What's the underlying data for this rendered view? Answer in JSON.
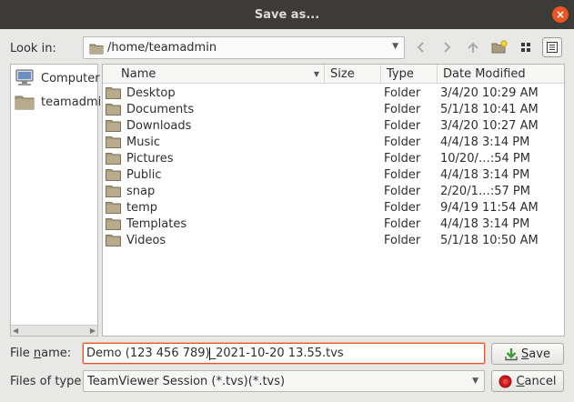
{
  "window": {
    "title": "Save as...",
    "close_glyph": "×"
  },
  "lookin": {
    "label": "Look in:",
    "path": "/home/teamadmin"
  },
  "toolbar_icons": [
    "back-icon",
    "forward-icon",
    "up-directory-icon",
    "new-folder-icon",
    "icon-view-icon",
    "detail-view-icon"
  ],
  "places": [
    {
      "label": "Computer",
      "icon": "computer-icon"
    },
    {
      "label": "teamadmin",
      "icon": "folder-icon"
    }
  ],
  "columns": {
    "name": "Name",
    "size": "Size",
    "type": "Type",
    "date": "Date Modified"
  },
  "files": [
    {
      "name": "Desktop",
      "type": "Folder",
      "date": "3/4/20 10:29 AM"
    },
    {
      "name": "Documents",
      "type": "Folder",
      "date": "5/1/18 10:41 AM"
    },
    {
      "name": "Downloads",
      "type": "Folder",
      "date": "3/4/20 10:27 AM"
    },
    {
      "name": "Music",
      "type": "Folder",
      "date": "4/4/18 3:14 PM"
    },
    {
      "name": "Pictures",
      "type": "Folder",
      "date": "10/20/…:54 PM"
    },
    {
      "name": "Public",
      "type": "Folder",
      "date": "4/4/18 3:14 PM"
    },
    {
      "name": "snap",
      "type": "Folder",
      "date": "2/20/1…:57 PM"
    },
    {
      "name": "temp",
      "type": "Folder",
      "date": "9/4/19 11:54 AM"
    },
    {
      "name": "Templates",
      "type": "Folder",
      "date": "4/4/18 3:14 PM"
    },
    {
      "name": "Videos",
      "type": "Folder",
      "date": "5/1/18 10:50 AM"
    }
  ],
  "filename": {
    "label_pre": "File ",
    "label_u": "n",
    "label_post": "ame:",
    "value_before_caret": "Demo (123 456 789)",
    "value_after_caret": "_2021-10-20 13.55.tvs"
  },
  "filetype": {
    "label": "Files of type:",
    "value": "TeamViewer Session (*.tvs)(*.tvs)"
  },
  "buttons": {
    "save_u": "S",
    "save_rest": "ave",
    "cancel_u": "C",
    "cancel_rest": "ancel"
  },
  "colors": {
    "titlebar": "#3c3b37",
    "accent": "#e95420",
    "folder": "#a89a7c"
  }
}
